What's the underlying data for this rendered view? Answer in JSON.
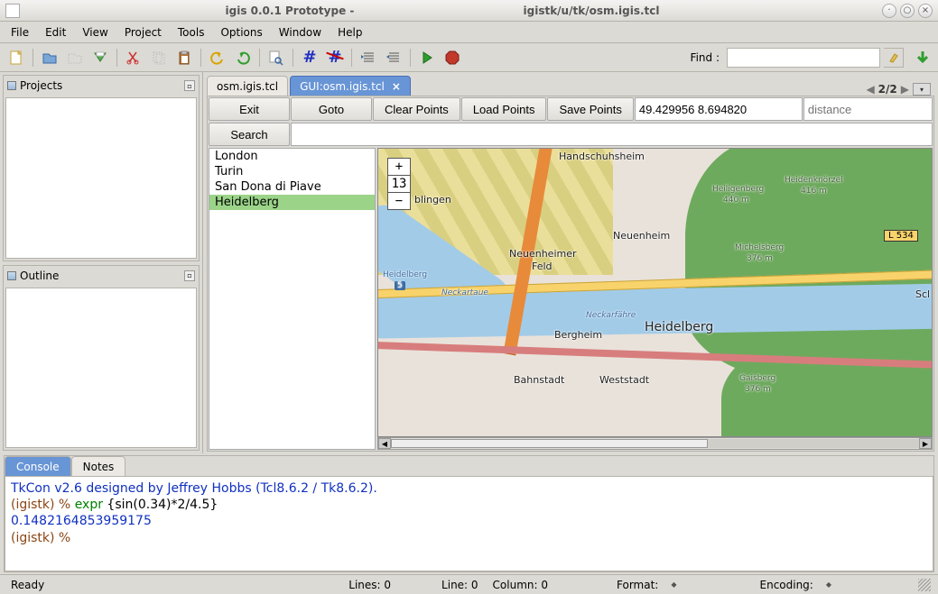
{
  "titlebar": {
    "left": "igis 0.0.1 Prototype -",
    "right": "igistk/u/tk/osm.igis.tcl"
  },
  "menu": {
    "items": [
      "File",
      "Edit",
      "View",
      "Project",
      "Tools",
      "Options",
      "Window",
      "Help"
    ]
  },
  "toolbar": {
    "find_label": "Find :",
    "find_value": ""
  },
  "panels": {
    "projects_title": "Projects",
    "outline_title": "Outline"
  },
  "tabs": {
    "items": [
      {
        "label": "osm.igis.tcl",
        "active": false
      },
      {
        "label": "GUI:osm.igis.tcl",
        "active": true,
        "closable": true
      }
    ],
    "position": "2/2"
  },
  "gis": {
    "buttons": {
      "exit": "Exit",
      "goto": "Goto",
      "clear": "Clear Points",
      "load": "Load Points",
      "save": "Save Points",
      "search": "Search"
    },
    "coord_value": "49.429956 8.694820",
    "distance_placeholder": "distance",
    "search_value": "",
    "cities": [
      "London",
      "Turin",
      "San Dona di Piave",
      "Heidelberg"
    ],
    "selected_city": "Heidelberg",
    "zoom_level": "13",
    "map_labels": {
      "handschuhsheim": "Handschuhsheim",
      "neuenheim": "Neuenheim",
      "neuenheimer": "Neuenheimer",
      "feld": "Feld",
      "heidelberg": "Heidelberg",
      "heidelberg_exit": "Heidelberg",
      "bergheim": "Bergheim",
      "bahnstadt": "Bahnstadt",
      "weststadt": "Weststadt",
      "sch": "Scl",
      "blingen": "blingen",
      "neck1": "Neckartaue",
      "neckarfahre": "Neckarfähre",
      "heiligenberg": "Heiligenberg",
      "heiligenberg_h": "440 m",
      "heidenknorzel": "Heidenknörzel",
      "heidenknorzel_h": "416 m",
      "michelsberg": "Michelsberg",
      "michelsberg_h": "376 m",
      "gaisberg": "Gaisberg",
      "gaisberg_h": "376 m",
      "road": "L 534",
      "exit5": "5"
    }
  },
  "console": {
    "tabs": [
      "Console",
      "Notes"
    ],
    "line1": "TkCon v2.6 designed by Jeffrey Hobbs (Tcl8.6.2 / Tk8.6.2).",
    "prompt1_a": "(igistk) % ",
    "prompt1_cmd": "expr",
    "prompt1_rest": " {sin(0.34)*2/4.5}",
    "result": "0.1482164853959175",
    "prompt2": "(igistk) % "
  },
  "status": {
    "ready": "Ready",
    "lines": "Lines: 0",
    "line": "Line: 0",
    "column": "Column: 0",
    "format": "Format:",
    "encoding": "Encoding:"
  }
}
